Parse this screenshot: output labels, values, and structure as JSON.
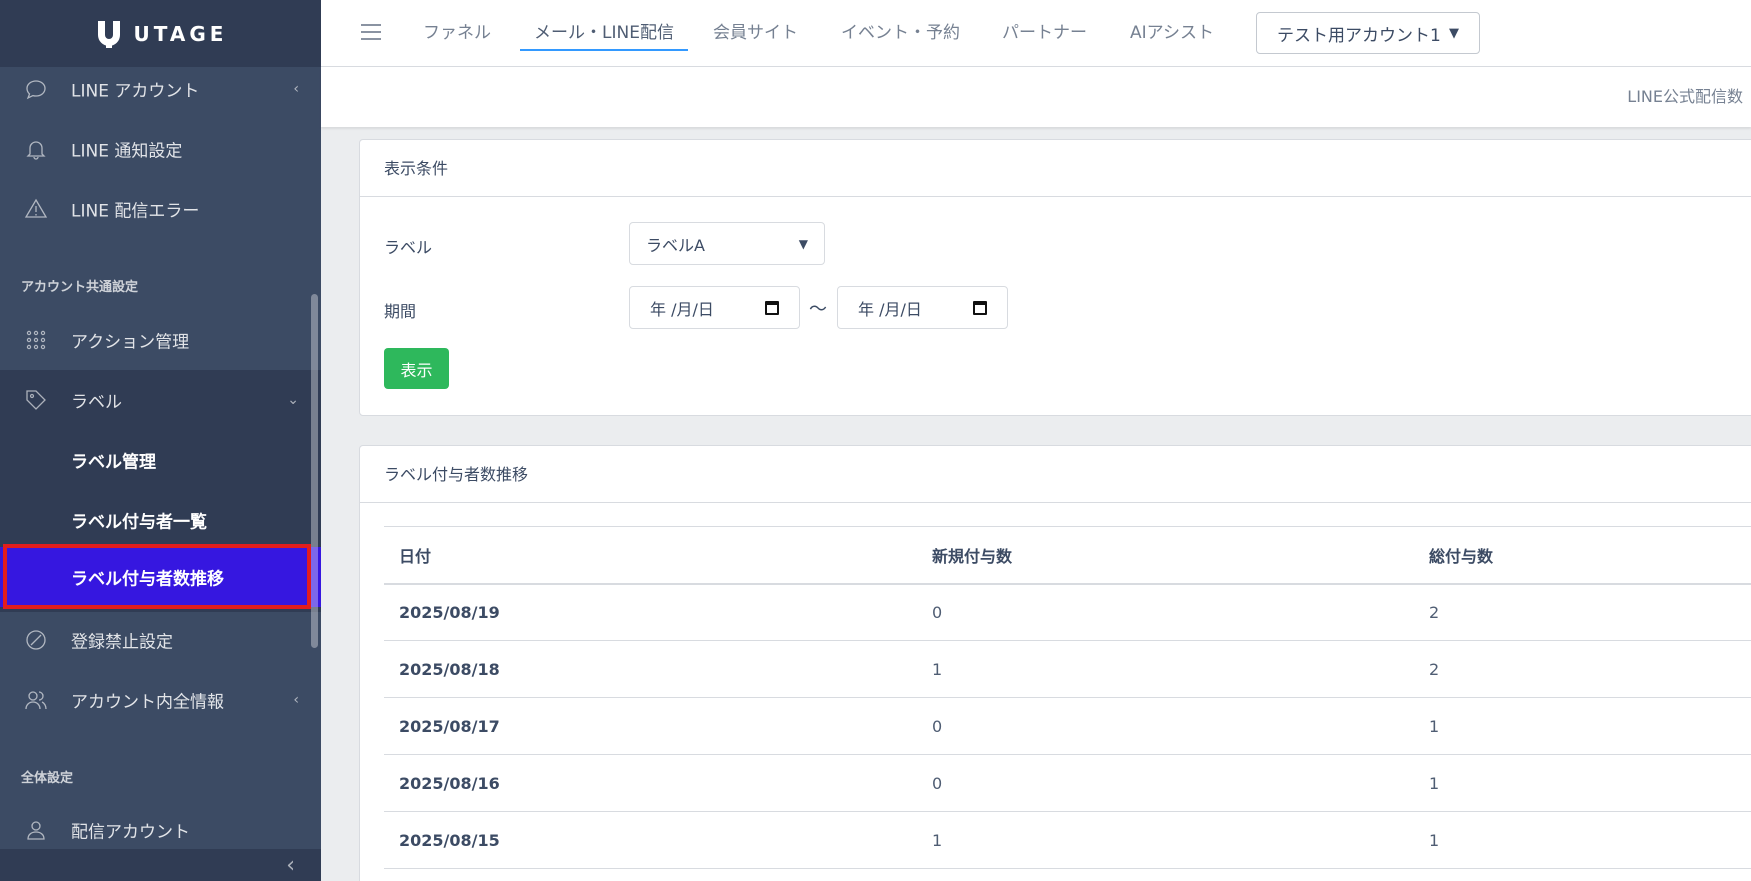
{
  "brand": {
    "name": "UTAGE"
  },
  "header": {
    "nav": [
      "ファネル",
      "メール・LINE配信",
      "会員サイト",
      "イベント・予約",
      "パートナー",
      "AIアシスト"
    ],
    "active_nav": "メール・LINE配信",
    "account_select": "テスト用アカウント1",
    "subheader_right": "LINE公式配信数"
  },
  "sidebar": {
    "items": {
      "line_account": "LINE アカウント",
      "line_notify": "LINE 通知設定",
      "line_error": "LINE 配信エラー",
      "section_account_common": "アカウント共通設定",
      "action_manage": "アクション管理",
      "label": "ラベル",
      "label_manage": "ラベル管理",
      "label_users": "ラベル付与者一覧",
      "label_trend": "ラベル付与者数推移",
      "block_settings": "登録禁止設定",
      "account_all_info": "アカウント内全情報",
      "section_global": "全体設定",
      "delivery_account": "配信アカウント"
    }
  },
  "filter_card": {
    "title": "表示条件",
    "label_field": "ラベル",
    "label_value": "ラベルA",
    "period_field": "期間",
    "date_placeholder": "年 /月/日",
    "tilde": "〜",
    "show_button": "表示"
  },
  "trend_card": {
    "title": "ラベル付与者数推移",
    "columns": [
      "日付",
      "新規付与数",
      "総付与数"
    ],
    "rows": [
      [
        "2025/08/19",
        "0",
        "2"
      ],
      [
        "2025/08/18",
        "1",
        "2"
      ],
      [
        "2025/08/17",
        "0",
        "1"
      ],
      [
        "2025/08/16",
        "0",
        "1"
      ],
      [
        "2025/08/15",
        "1",
        "1"
      ]
    ]
  }
}
